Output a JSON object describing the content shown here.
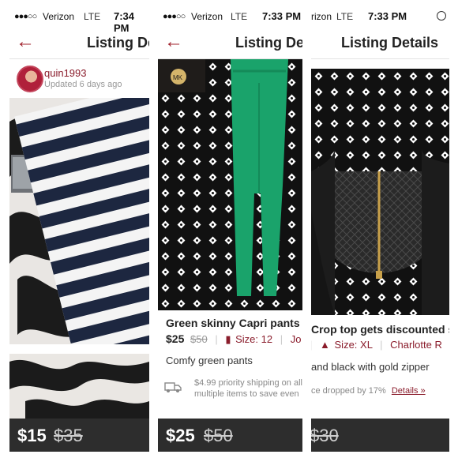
{
  "panels": [
    {
      "status": {
        "carrier": "Verizon",
        "network": "LTE",
        "time": "7:34 PM"
      },
      "nav": {
        "title": "Listing Details"
      },
      "seller": {
        "username": "quin1993",
        "updated": "Updated 6 days ago"
      },
      "price": {
        "current": "$15",
        "original": "$35"
      }
    },
    {
      "status": {
        "carrier": "Verizon",
        "network": "LTE",
        "time": "7:33 PM"
      },
      "nav": {
        "title": "Listing Details"
      },
      "item": {
        "title": "Green skinny Capri pants",
        "price": "$25",
        "original": "$50",
        "size": "Size: 12",
        "brand": "Jo",
        "description": "Comfy green pants",
        "shipping": "$4.99 priority shipping on all multiple items to save even"
      },
      "price": {
        "current": "$25",
        "original": "$50"
      }
    },
    {
      "status": {
        "carrier": "Verizon",
        "network": "LTE",
        "time": "7:33 PM"
      },
      "nav": {
        "title": "Listing Details"
      },
      "item": {
        "title": "Crop top gets discounted shi",
        "size": "Size: XL",
        "brand": "Charlotte R",
        "description": "and black  with gold zipper",
        "price_drop": "ce dropped by 17%",
        "details_link": "Details »"
      },
      "price": {
        "original": "$30"
      }
    }
  ],
  "colors": {
    "accent": "#a1202b",
    "price_bar": "#2d2d2d",
    "pants_green": "#1aa36b"
  }
}
